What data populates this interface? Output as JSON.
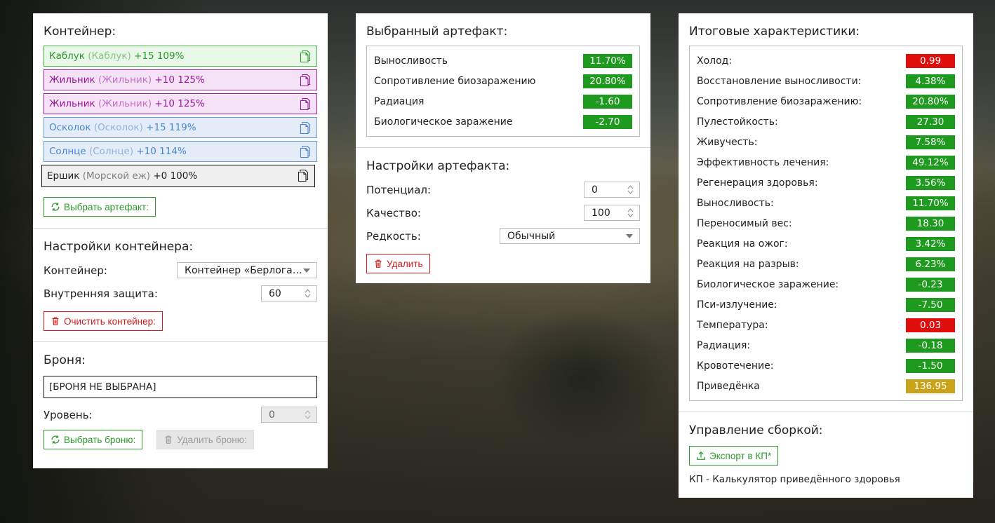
{
  "colors": {
    "green": "#1e9a1e",
    "red": "#e00d0d",
    "gold": "#c9a31a",
    "purple": "#9b179b",
    "blue": "#4a86cf"
  },
  "container_panel": {
    "title": "Контейнер:",
    "items": [
      {
        "name": "Каблук",
        "alias": "(Каблук)",
        "stats": "+15 109%",
        "color": "green"
      },
      {
        "name": "Жильник",
        "alias": "(Жильник)",
        "stats": "+10 125%",
        "color": "purple"
      },
      {
        "name": "Жильник",
        "alias": "(Жильник)",
        "stats": "+10 125%",
        "color": "purple"
      },
      {
        "name": "Осколок",
        "alias": "(Осколок)",
        "stats": "+15 119%",
        "color": "blue"
      },
      {
        "name": "Солнце",
        "alias": "(Солнце)",
        "stats": "+10 114%",
        "color": "blue"
      },
      {
        "name": "Ершик",
        "alias": "(Морской еж)",
        "stats": "+0 100%",
        "color": "black"
      }
    ],
    "select_artifact_label": "Выбрать артефакт:",
    "settings_title": "Настройки контейнера:",
    "container_label": "Контейнер:",
    "container_value": "Контейнер «Берлога…",
    "inner_protection_label": "Внутренняя защита:",
    "inner_protection_value": "60",
    "clear_label": "Очистить контейнер:",
    "armor_title": "Броня:",
    "armor_value": "[БРОНЯ НЕ ВЫБРАНА]",
    "level_label": "Уровень:",
    "level_value": "0",
    "select_armor_label": "Выбрать броню:",
    "delete_armor_label": "Удалить броню:"
  },
  "artifact_panel": {
    "title": "Выбранный артефакт:",
    "stats": [
      {
        "label": "Выносливость",
        "value": "11.70%",
        "color": "green"
      },
      {
        "label": "Сопротивление биозаражению",
        "value": "20.80%",
        "color": "green"
      },
      {
        "label": "Радиация",
        "value": "-1.60",
        "color": "green"
      },
      {
        "label": "Биологическое заражение",
        "value": "-2.70",
        "color": "green"
      }
    ],
    "settings_title": "Настройки артефакта:",
    "potential_label": "Потенциал:",
    "potential_value": "0",
    "quality_label": "Качество:",
    "quality_value": "100",
    "rarity_label": "Редкость:",
    "rarity_value": "Обычный",
    "delete_label": "Удалить"
  },
  "totals_panel": {
    "title": "Итоговые характеристики:",
    "stats": [
      {
        "label": "Холод:",
        "value": "0.99",
        "color": "red"
      },
      {
        "label": "Восстановление выносливости:",
        "value": "4.38%",
        "color": "green"
      },
      {
        "label": "Сопротивление биозаражению:",
        "value": "20.80%",
        "color": "green"
      },
      {
        "label": "Пулестойкость:",
        "value": "27.30",
        "color": "green"
      },
      {
        "label": "Живучесть:",
        "value": "7.58%",
        "color": "green"
      },
      {
        "label": "Эффективность лечения:",
        "value": "49.12%",
        "color": "green"
      },
      {
        "label": "Регенерация здоровья:",
        "value": "3.56%",
        "color": "green"
      },
      {
        "label": "Выносливость:",
        "value": "11.70%",
        "color": "green"
      },
      {
        "label": "Переносимый вес:",
        "value": "18.30",
        "color": "green"
      },
      {
        "label": "Реакция на ожог:",
        "value": "3.42%",
        "color": "green"
      },
      {
        "label": "Реакция на разрыв:",
        "value": "6.23%",
        "color": "green"
      },
      {
        "label": "Биологическое заражение:",
        "value": "-0.23",
        "color": "green"
      },
      {
        "label": "Пси-излучение:",
        "value": "-7.50",
        "color": "green"
      },
      {
        "label": "Температура:",
        "value": "0.03",
        "color": "red"
      },
      {
        "label": "Радиация:",
        "value": "-0.18",
        "color": "green"
      },
      {
        "label": "Кровотечение:",
        "value": "-1.50",
        "color": "green"
      },
      {
        "label": "Приведёнка",
        "value": "136.95",
        "color": "gold"
      }
    ],
    "build_title": "Управление сборкой:",
    "export_label": "Экспорт в КП*",
    "note": "КП - Калькулятор приведённого здоровья"
  }
}
